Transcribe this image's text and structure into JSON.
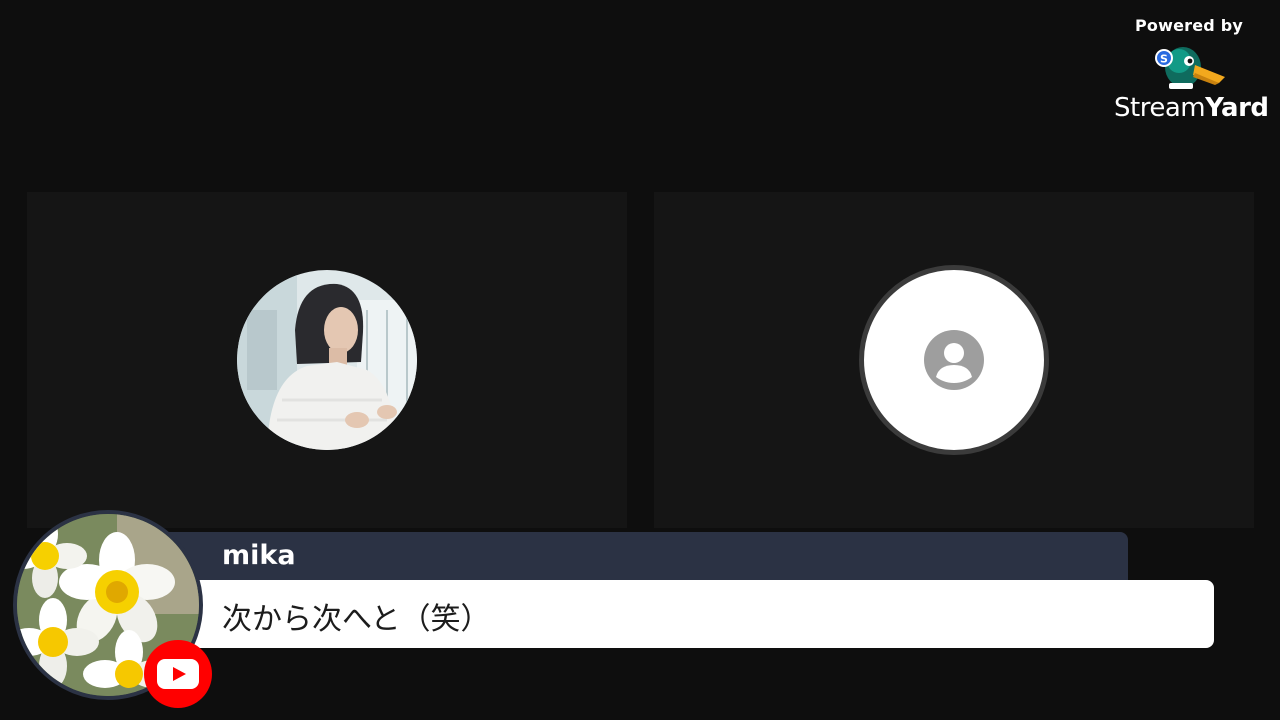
{
  "branding": {
    "powered_by": "Powered by",
    "name_light": "Stream",
    "name_bold": "Yard",
    "logo_icon": "duck-logo-icon"
  },
  "participants": [
    {
      "id": "participant-1",
      "avatar_type": "photo",
      "avatar_icon": "woman-photo"
    },
    {
      "id": "participant-2",
      "avatar_type": "placeholder",
      "avatar_icon": "user-placeholder-icon"
    }
  ],
  "comment": {
    "author": "mika",
    "message": "次から次へと（笑）",
    "platform_icon": "youtube-icon",
    "avatar_icon": "daffodil-flower-photo"
  },
  "colors": {
    "background": "#0e0e0e",
    "tile": "#151515",
    "name_bar": "#2b3244",
    "message_bar": "#ffffff",
    "youtube_red": "#ff0000"
  }
}
